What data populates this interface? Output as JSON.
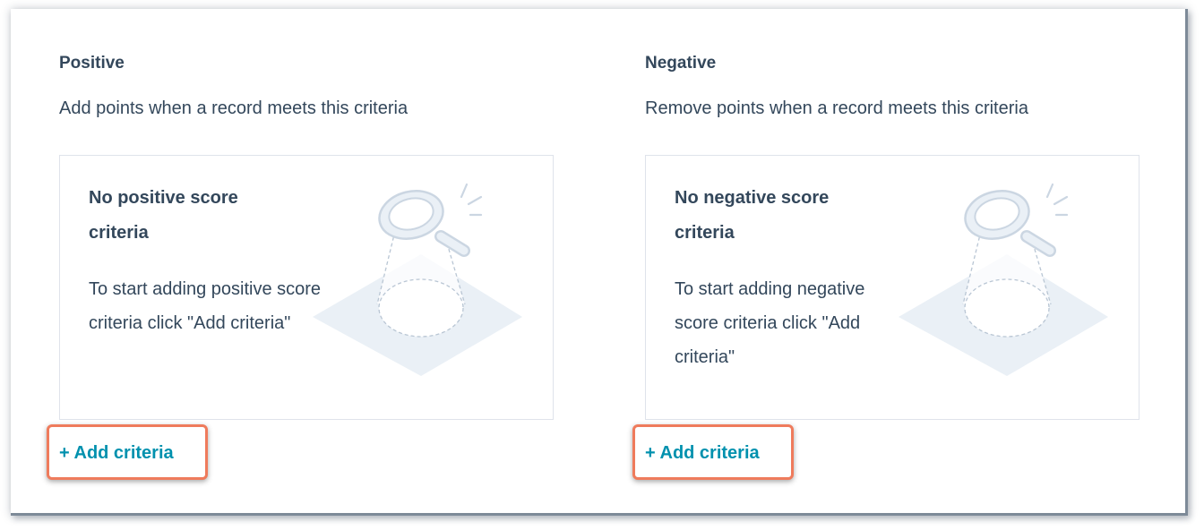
{
  "positive": {
    "title": "Positive",
    "subtitle": "Add points when a record meets this criteria",
    "empty_title": "No positive score criteria",
    "empty_text": "To start adding positive score criteria click \"Add criteria\"",
    "add_label": "+ Add criteria"
  },
  "negative": {
    "title": "Negative",
    "subtitle": "Remove points when a record meets this criteria",
    "empty_title": "No negative score criteria",
    "empty_text": "To start adding negative score criteria click \"Add criteria\"",
    "add_label": "+ Add criteria"
  },
  "icons": {
    "empty_state": "magnifying-glass-spotlight-icon"
  },
  "colors": {
    "text": "#33475b",
    "link": "#0091ae",
    "highlight": "#ef7b5c",
    "card_border": "#dfe3eb",
    "illustration": "#eaf0f6"
  }
}
